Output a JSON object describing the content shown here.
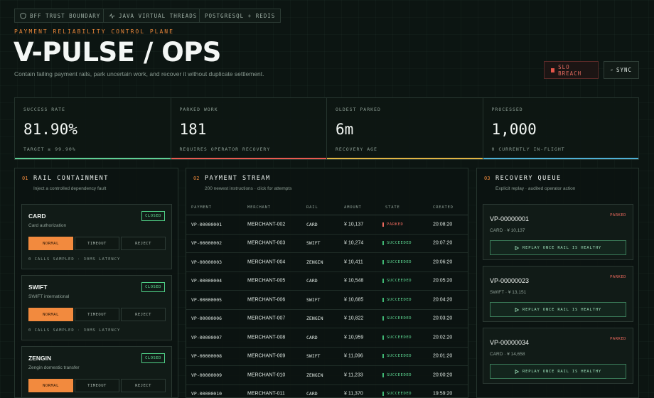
{
  "top_chips": [
    {
      "icon": "shield-icon",
      "label": "BFF TRUST BOUNDARY"
    },
    {
      "icon": "pulse-icon",
      "label": "JAVA VIRTUAL THREADS"
    },
    {
      "icon": "",
      "label": "POSTGRESQL + REDIS"
    }
  ],
  "header": {
    "eyebrow": "PAYMENT RELIABILITY CONTROL PLANE",
    "title": "V-PULSE / OPS",
    "subtitle": "Contain failing payment rails, park uncertain work, and recover it without duplicate settlement.",
    "slo_label": "SLO BREACH",
    "sync_label": "SYNC"
  },
  "colors": {
    "accent": "#e8863a",
    "ok": "#5fdc95",
    "alert": "#ef6a5e"
  },
  "stats": [
    {
      "label": "SUCCESS RATE",
      "value": "81.90%",
      "foot": "TARGET ≥ 99.90%",
      "bar": "#5fcf95"
    },
    {
      "label": "PARKED WORK",
      "value": "181",
      "foot": "REQUIRES OPERATOR RECOVERY",
      "bar": "#e85a50"
    },
    {
      "label": "OLDEST PARKED",
      "value": "6m",
      "foot": "RECOVERY AGE",
      "bar": "#e0b545"
    },
    {
      "label": "PROCESSED",
      "value": "1,000",
      "foot": "0 CURRENTLY IN-FLIGHT",
      "bar": "#4fb0d5"
    }
  ],
  "rail_panel": {
    "num": "01",
    "title": "RAIL CONTAINMENT",
    "subtitle": "Inject a controlled dependency fault",
    "modes": [
      "NORMAL",
      "TIMEOUT",
      "REJECT"
    ],
    "rails": [
      {
        "name": "CARD",
        "desc": "Card authorization",
        "status": "CLOSED",
        "meta": "0 CALLS SAMPLED · 30MS LATENCY"
      },
      {
        "name": "SWIFT",
        "desc": "SWIFT international",
        "status": "CLOSED",
        "meta": "0 CALLS SAMPLED · 30MS LATENCY"
      },
      {
        "name": "ZENGIN",
        "desc": "Zengin domestic transfer",
        "status": "CLOSED",
        "meta": ""
      }
    ]
  },
  "stream_panel": {
    "num": "02",
    "title": "PAYMENT STREAM",
    "subtitle": "200 newest instructions · click for attempts",
    "columns": [
      "PAYMENT",
      "MERCHANT",
      "RAIL",
      "AMOUNT",
      "STATE",
      "CREATED"
    ],
    "rows": [
      {
        "id": "VP-00000001",
        "merchant": "MERCHANT-002",
        "rail": "CARD",
        "amount": "¥ 10,137",
        "state": "PARKED",
        "created": "20:08:20"
      },
      {
        "id": "VP-00000002",
        "merchant": "MERCHANT-003",
        "rail": "SWIFT",
        "amount": "¥ 10,274",
        "state": "SUCCEEDED",
        "created": "20:07:20"
      },
      {
        "id": "VP-00000003",
        "merchant": "MERCHANT-004",
        "rail": "ZENGIN",
        "amount": "¥ 10,411",
        "state": "SUCCEEDED",
        "created": "20:06:20"
      },
      {
        "id": "VP-00000004",
        "merchant": "MERCHANT-005",
        "rail": "CARD",
        "amount": "¥ 10,548",
        "state": "SUCCEEDED",
        "created": "20:05:20"
      },
      {
        "id": "VP-00000005",
        "merchant": "MERCHANT-006",
        "rail": "SWIFT",
        "amount": "¥ 10,685",
        "state": "SUCCEEDED",
        "created": "20:04:20"
      },
      {
        "id": "VP-00000006",
        "merchant": "MERCHANT-007",
        "rail": "ZENGIN",
        "amount": "¥ 10,822",
        "state": "SUCCEEDED",
        "created": "20:03:20"
      },
      {
        "id": "VP-00000007",
        "merchant": "MERCHANT-008",
        "rail": "CARD",
        "amount": "¥ 10,959",
        "state": "SUCCEEDED",
        "created": "20:02:20"
      },
      {
        "id": "VP-00000008",
        "merchant": "MERCHANT-009",
        "rail": "SWIFT",
        "amount": "¥ 11,096",
        "state": "SUCCEEDED",
        "created": "20:01:20"
      },
      {
        "id": "VP-00000009",
        "merchant": "MERCHANT-010",
        "rail": "ZENGIN",
        "amount": "¥ 11,233",
        "state": "SUCCEEDED",
        "created": "20:00:20"
      },
      {
        "id": "VP-00000010",
        "merchant": "MERCHANT-011",
        "rail": "CARD",
        "amount": "¥ 11,370",
        "state": "SUCCEEDED",
        "created": "19:59:20"
      }
    ]
  },
  "recovery_panel": {
    "num": "03",
    "title": "RECOVERY QUEUE",
    "subtitle": "Explicit replay · audited operator action",
    "items": [
      {
        "id": "VP-00000001",
        "tag": "PARKED",
        "meta": "CARD · ¥ 10,137",
        "action": "REPLAY ONCE RAIL IS HEALTHY"
      },
      {
        "id": "VP-00000023",
        "tag": "PARKED",
        "meta": "SWIFT · ¥ 13,151",
        "action": "REPLAY ONCE RAIL IS HEALTHY"
      },
      {
        "id": "VP-00000034",
        "tag": "PARKED",
        "meta": "CARD · ¥ 14,658",
        "action": "REPLAY ONCE RAIL IS HEALTHY"
      }
    ]
  }
}
